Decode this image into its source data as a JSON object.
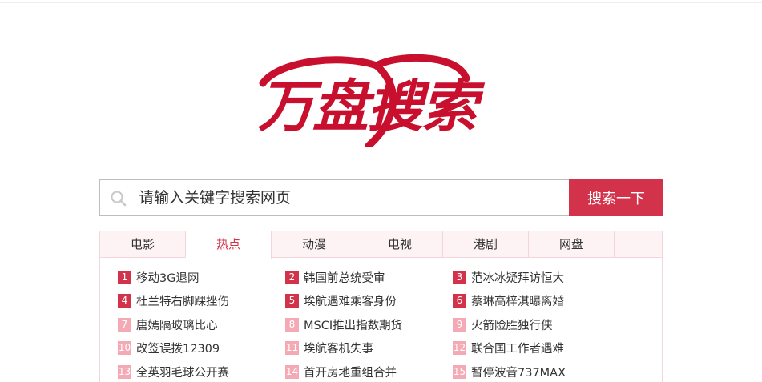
{
  "logo": {
    "text": "万盘搜索",
    "color": "#c8102e"
  },
  "search": {
    "placeholder": "请输入关键字搜索网页",
    "button_label": "搜索一下",
    "icon": "search-icon"
  },
  "tabs": [
    {
      "label": "电影",
      "active": false
    },
    {
      "label": "热点",
      "active": true
    },
    {
      "label": "动漫",
      "active": false
    },
    {
      "label": "电视",
      "active": false
    },
    {
      "label": "港剧",
      "active": false
    },
    {
      "label": "网盘",
      "active": false
    }
  ],
  "hot_list": [
    {
      "rank": "1",
      "text": "移动3G退网"
    },
    {
      "rank": "2",
      "text": "韩国前总统受审"
    },
    {
      "rank": "3",
      "text": "范冰冰疑拜访恒大"
    },
    {
      "rank": "4",
      "text": "杜兰特右脚踝挫伤"
    },
    {
      "rank": "5",
      "text": "埃航遇难乘客身份"
    },
    {
      "rank": "6",
      "text": "蔡琳高梓淇曝离婚"
    },
    {
      "rank": "7",
      "text": "唐嫣隔玻璃比心"
    },
    {
      "rank": "8",
      "text": "MSCI推出指数期货"
    },
    {
      "rank": "9",
      "text": "火箭险胜独行侠"
    },
    {
      "rank": "10",
      "text": "改签误拨12309"
    },
    {
      "rank": "11",
      "text": "埃航客机失事"
    },
    {
      "rank": "12",
      "text": "联合国工作者遇难"
    },
    {
      "rank": "13",
      "text": "全英羽毛球公开赛"
    },
    {
      "rank": "14",
      "text": "首开房地重组合并"
    },
    {
      "rank": "15",
      "text": "暂停波音737MAX"
    }
  ],
  "colors": {
    "accent": "#d3334a",
    "accent_light": "#f4aab5",
    "tab_bg": "#fdf3f4"
  }
}
